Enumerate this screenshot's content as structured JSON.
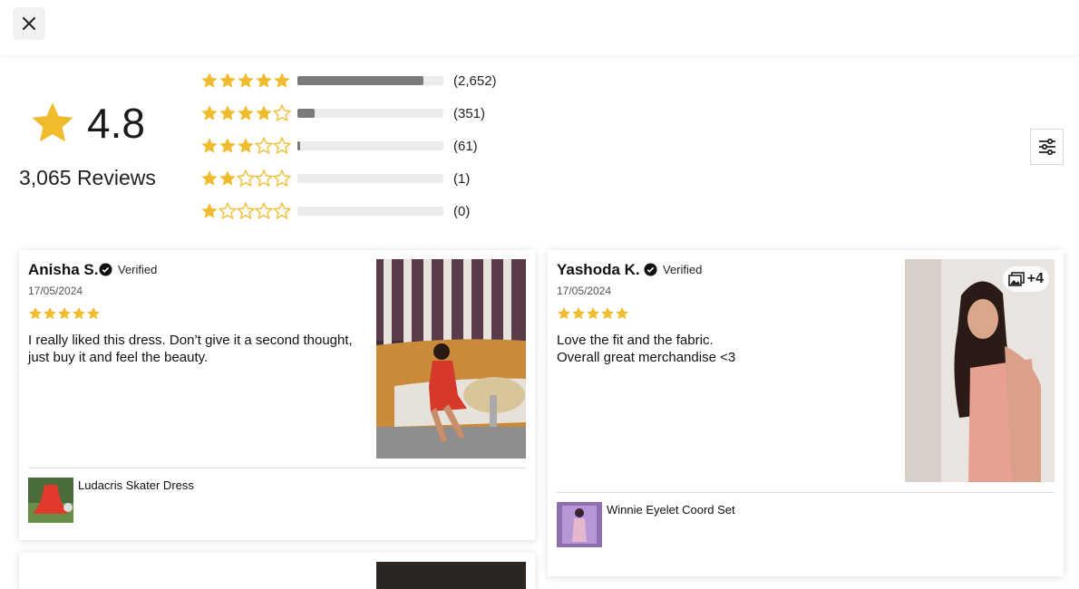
{
  "colors": {
    "star": "#f0bc2e",
    "bar_fill": "#7a7a7a",
    "bar_track": "#ececec"
  },
  "header": {
    "close_icon": "close-icon"
  },
  "summary": {
    "average": "4.8",
    "average_value": 4.8,
    "total_reviews": "3,065 Reviews",
    "distribution": [
      {
        "stars": 5,
        "count_label": "(2,652)",
        "count": 2652,
        "fraction": 0.865
      },
      {
        "stars": 4,
        "count_label": "(351)",
        "count": 351,
        "fraction": 0.115
      },
      {
        "stars": 3,
        "count_label": "(61)",
        "count": 61,
        "fraction": 0.02
      },
      {
        "stars": 2,
        "count_label": "(1)",
        "count": 1,
        "fraction": 0.0
      },
      {
        "stars": 1,
        "count_label": "(0)",
        "count": 0,
        "fraction": 0.0
      }
    ],
    "filter_icon": "sliders-icon"
  },
  "reviews": [
    {
      "name": "Anisha S.",
      "verified_label": "Verified",
      "date": "17/05/2024",
      "rating": 5,
      "text_lines": [
        "I really liked this dress. Don’t give it a second thought,",
        "just buy it and feel the beauty."
      ],
      "product_name": "Ludacris Skater Dress",
      "extra_photos": ""
    },
    {
      "name": "Yashoda K.",
      "verified_label": "Verified",
      "date": "17/05/2024",
      "rating": 5,
      "text_lines": [
        "Love the fit and the fabric.",
        "Overall great merchandise <3"
      ],
      "product_name": "Winnie Eyelet Coord Set",
      "extra_photos": "+4"
    }
  ]
}
